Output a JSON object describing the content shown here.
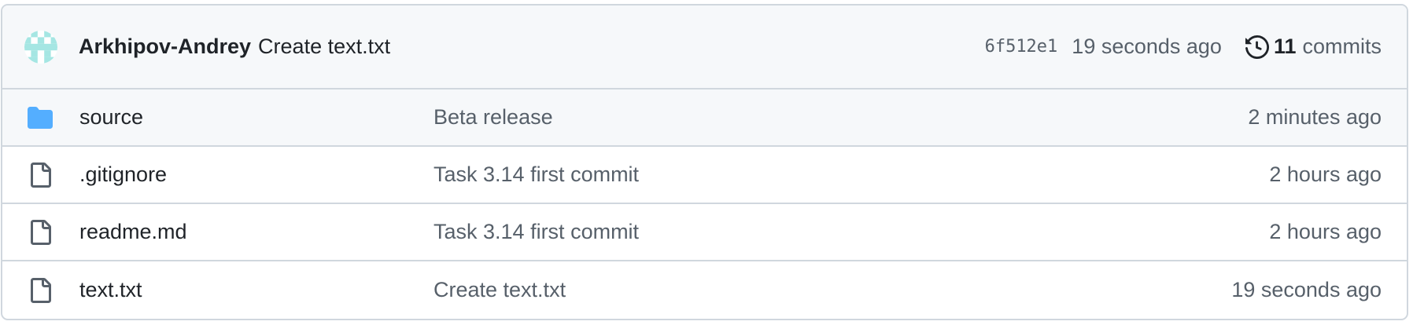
{
  "colors": {
    "folder": "#54aeff",
    "file_icon": "#57606a",
    "border": "#d0d7de",
    "header_bg": "#f6f8fa",
    "muted": "#57606a",
    "text": "#1f2328",
    "avatar": "#a5e6e3"
  },
  "header": {
    "avatar_icon": "identicon-avatar",
    "author": "Arkhipov-Andrey",
    "commit_message": "Create text.txt",
    "sha": "6f512e1",
    "time": "19 seconds ago",
    "history_icon": "history-icon",
    "commit_count": "11",
    "commits_label": "commits"
  },
  "files": [
    {
      "icon": "folder-icon",
      "name": "source",
      "message": "Beta release",
      "age": "2 minutes ago"
    },
    {
      "icon": "file-icon",
      "name": ".gitignore",
      "message": "Task 3.14 first commit",
      "age": "2 hours ago"
    },
    {
      "icon": "file-icon",
      "name": "readme.md",
      "message": "Task 3.14 first commit",
      "age": "2 hours ago"
    },
    {
      "icon": "file-icon",
      "name": "text.txt",
      "message": "Create text.txt",
      "age": "19 seconds ago"
    }
  ]
}
